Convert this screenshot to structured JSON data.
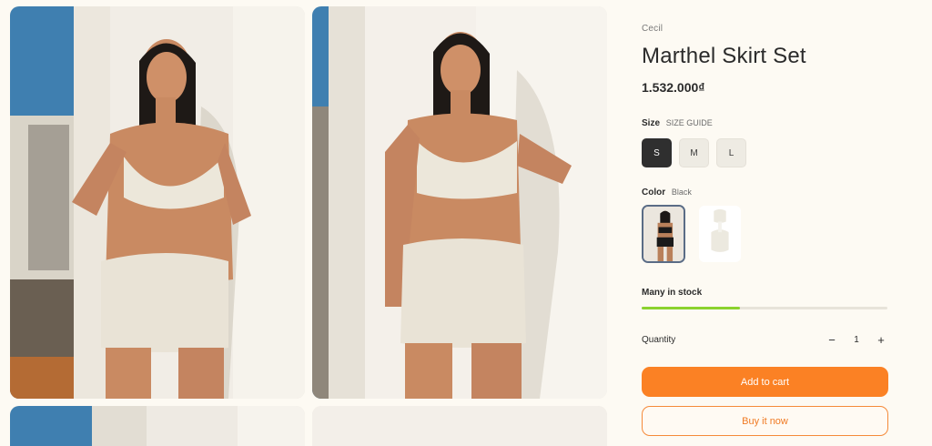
{
  "product": {
    "vendor": "Cecil",
    "title": "Marthel Skirt Set",
    "price": "1.532.000₫"
  },
  "size_option": {
    "label": "Size",
    "guide_link": "SIZE GUIDE",
    "values": [
      "S",
      "M",
      "L"
    ],
    "selected": "S"
  },
  "color_option": {
    "label": "Color",
    "selected": "Black"
  },
  "stock": {
    "text": "Many in stock",
    "level_fraction": 0.4
  },
  "quantity": {
    "label": "Quantity",
    "value": "1",
    "minus": "−",
    "plus": "+"
  },
  "actions": {
    "add_to_cart": "Add to cart",
    "buy_now": "Buy it now"
  },
  "colors": {
    "accent": "#fb8124",
    "stock_bar": "#8bd22e",
    "selected_size": "#2f2f2f",
    "page_bg": "#fdfaf3"
  },
  "icons": {
    "minus": "minus-icon",
    "plus": "plus-icon"
  }
}
